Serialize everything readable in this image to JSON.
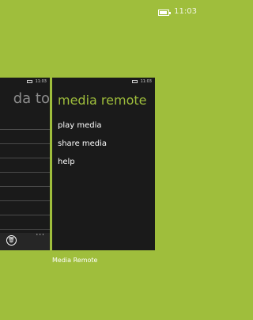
{
  "status_bar": {
    "time": "11:03",
    "battery_icon": "battery-charging-icon"
  },
  "left_card": {
    "time": "11:03",
    "title_fragment": "da to",
    "appbar_icon": "trash-icon",
    "more_label": "···"
  },
  "main_card": {
    "time": "11:03",
    "title": "media remote",
    "menu": [
      "play media",
      "share media",
      "help"
    ],
    "label": "Media Remote"
  },
  "colors": {
    "background": "#9fbe3c",
    "card": "#1a1a1a",
    "accent": "#9fbe3c"
  }
}
